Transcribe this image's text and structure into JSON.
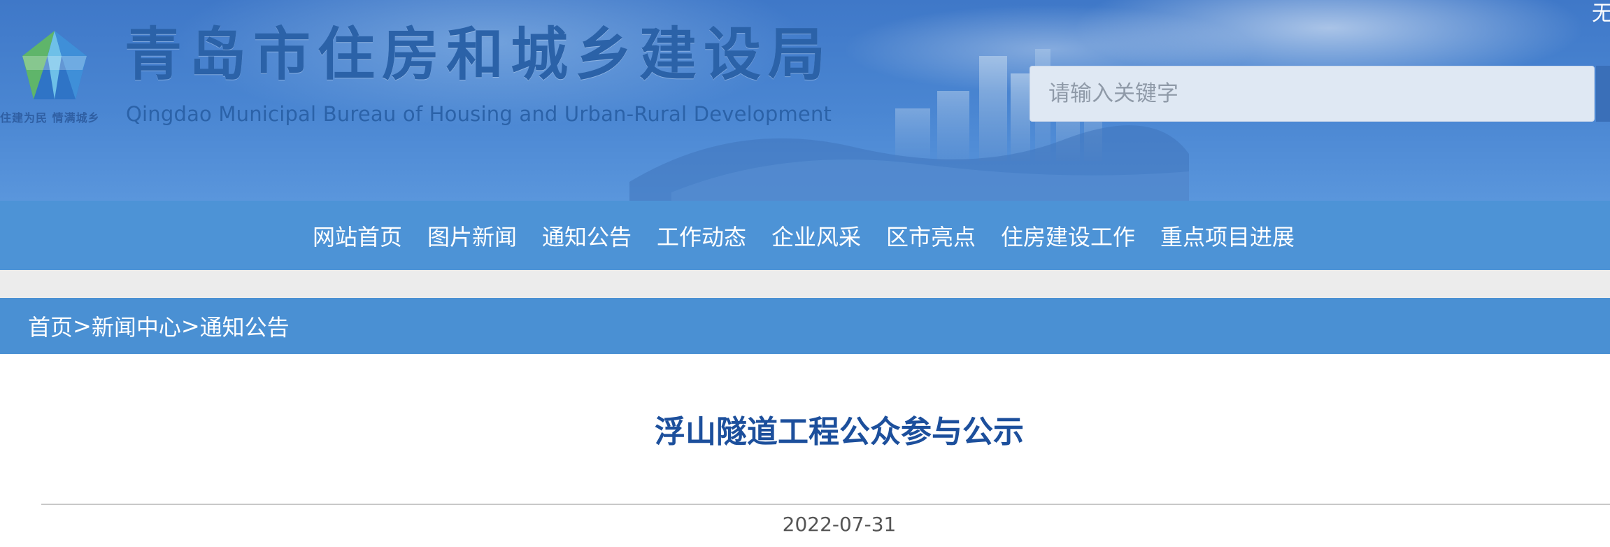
{
  "header": {
    "title": "青岛市住房和城乡建设局",
    "subtitle": "Qingdao Municipal Bureau of Housing and Urban-Rural Development",
    "slogan": "住建为民 情满城乡",
    "corner_text": "无"
  },
  "search": {
    "placeholder": "请输入关键字",
    "value": ""
  },
  "nav": {
    "items": [
      {
        "label": "网站首页"
      },
      {
        "label": "图片新闻"
      },
      {
        "label": "通知公告"
      },
      {
        "label": "工作动态"
      },
      {
        "label": "企业风采"
      },
      {
        "label": "区市亮点"
      },
      {
        "label": "住房建设工作"
      },
      {
        "label": "重点项目进展"
      }
    ]
  },
  "breadcrumb": {
    "items": [
      {
        "label": "首页"
      },
      {
        "label": "新闻中心"
      },
      {
        "label": "通知公告"
      }
    ],
    "separator": ">"
  },
  "article": {
    "title": "浮山隧道工程公众参与公示",
    "date": "2022-07-31"
  },
  "colors": {
    "header_blue": "#4a86d2",
    "nav_blue": "#4d93d6",
    "breadcrumb_blue": "#4a90d3",
    "title_blue": "#1c4f9c",
    "logo_blue": "#2b62a8",
    "logo_green": "#5fb56a"
  },
  "icons": {
    "logo": "bureau-logo-icon",
    "skyline": "city-skyline-illustration"
  }
}
